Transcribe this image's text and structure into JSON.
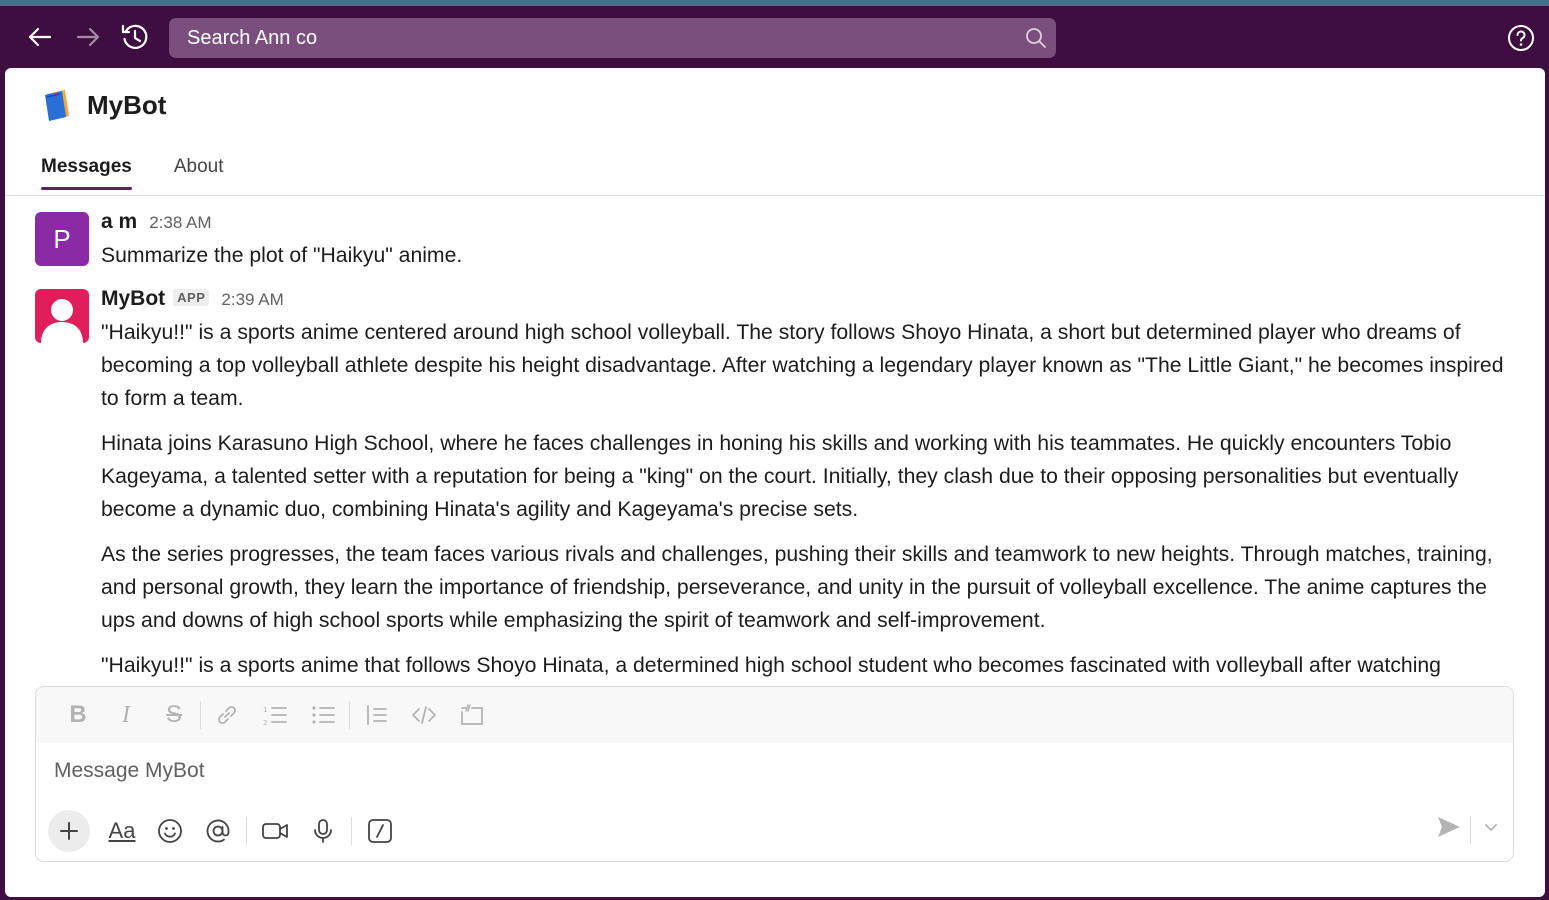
{
  "search": {
    "text": "Search Ann co"
  },
  "header": {
    "title": "MyBot"
  },
  "tabs": [
    {
      "label": "Messages"
    },
    {
      "label": "About"
    }
  ],
  "messages": [
    {
      "avatar_letter": "P",
      "sender": "a m",
      "time": "2:38 AM",
      "paragraphs": [
        "Summarize the plot of \"Haikyu\" anime."
      ]
    },
    {
      "sender": "MyBot",
      "badge": "APP",
      "time": "2:39 AM",
      "paragraphs": [
        "\"Haikyu!!\" is a sports anime centered around high school volleyball. The story follows Shoyo Hinata, a short but determined player who dreams of becoming a top volleyball athlete despite his height disadvantage. After watching a legendary player known as \"The Little Giant,\" he becomes inspired to form a team.",
        "Hinata joins Karasuno High School, where he faces challenges in honing his skills and working with his teammates. He quickly encounters Tobio Kageyama, a talented setter with a reputation for being a \"king\" on the court. Initially, they clash due to their opposing personalities but eventually become a dynamic duo, combining Hinata's agility and Kageyama's precise sets.",
        "As the series progresses, the team faces various rivals and challenges, pushing their skills and teamwork to new heights. Through matches, training, and personal growth, they learn the importance of friendship, perseverance, and unity in the pursuit of volleyball excellence. The anime captures the ups and downs of high school sports while emphasizing the spirit of teamwork and self-improvement.",
        "\"Haikyu!!\" is a sports anime that follows Shoyo Hinata, a determined high school student who becomes fascinated with volleyball after watching"
      ]
    }
  ],
  "composer": {
    "placeholder": "Message MyBot",
    "aa_label": "Aa"
  },
  "colors": {
    "sidebar": "#3f0e40",
    "search_bg": "#7a4f7d",
    "accent": "#611f69",
    "avatar_p": "#8a2ba5",
    "avatar_bot": "#e01e5a"
  }
}
